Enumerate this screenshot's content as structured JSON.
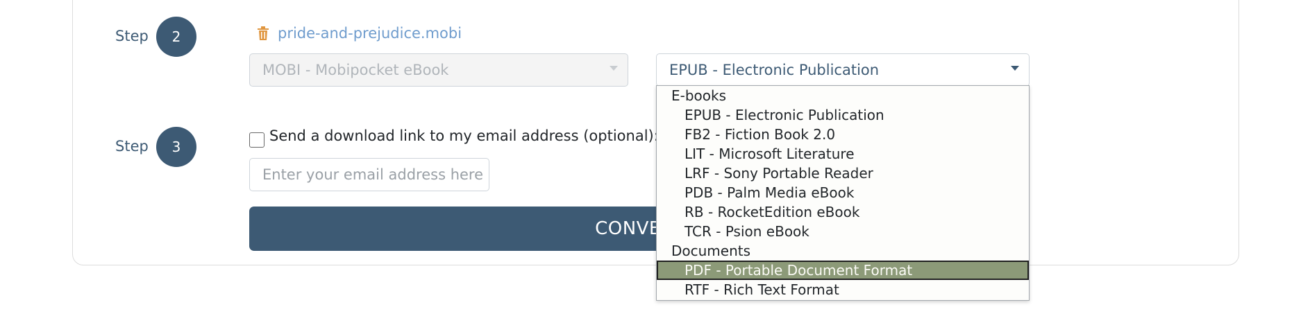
{
  "step2": {
    "label": "Step",
    "number": "2",
    "file_name": "pride-and-prejudice.mobi",
    "source_format": "MOBI - Mobipocket eBook",
    "target_format": "EPUB - Electronic Publication"
  },
  "step3": {
    "label": "Step",
    "number": "3",
    "checkbox_label": "Send a download link to my email address (optional):",
    "email_value": "",
    "email_placeholder": "Enter your email address here",
    "checkbox_checked": false
  },
  "convert_button": {
    "label": "CONVERT"
  },
  "dropdown": {
    "groups": [
      {
        "label": "E-books",
        "options": [
          "EPUB - Electronic Publication",
          "FB2 - Fiction Book 2.0",
          "LIT - Microsoft Literature",
          "LRF - Sony Portable Reader",
          "PDB - Palm Media eBook",
          "RB - RocketEdition eBook",
          "TCR - Psion eBook"
        ]
      },
      {
        "label": "Documents",
        "options": [
          "PDF - Portable Document Format",
          "RTF - Rich Text Format"
        ]
      }
    ],
    "highlighted_option": "PDF - Portable Document Format"
  },
  "colors": {
    "primary": "#3d5a74",
    "file_link": "#6f9ccd",
    "trash_icon": "#e0963f",
    "highlight": "#8c9a78"
  }
}
